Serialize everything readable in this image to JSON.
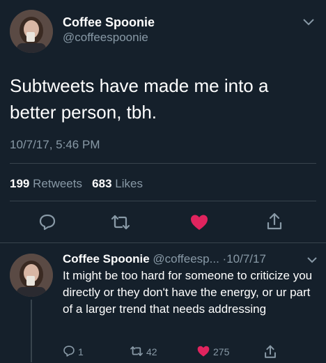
{
  "main_tweet": {
    "author_name": "Coffee Spoonie",
    "author_handle": "@coffeespoonie",
    "text": "Subtweets have made me into a better person, tbh.",
    "timestamp": "10/7/17, 5:46 PM",
    "retweet_count": "199",
    "retweet_label": "Retweets",
    "like_count": "683",
    "like_label": "Likes"
  },
  "reply_tweet": {
    "author_name": "Coffee Spoonie",
    "author_handle": "@coffeesp...",
    "date": "·10/7/17",
    "text": "It might be too hard for someone to criticize you directly or they don't have the energy, or ur part of a larger trend that needs addressing",
    "reply_count": "1",
    "retweet_count": "42",
    "like_count": "275"
  },
  "icons": {
    "reply": "reply-icon",
    "retweet": "retweet-icon",
    "like": "heart-icon",
    "share": "share-icon",
    "menu": "chevron-down-icon"
  },
  "colors": {
    "background": "#15202b",
    "secondary_text": "#8899a6",
    "like_active": "#e0245e",
    "divider": "#38444d"
  }
}
